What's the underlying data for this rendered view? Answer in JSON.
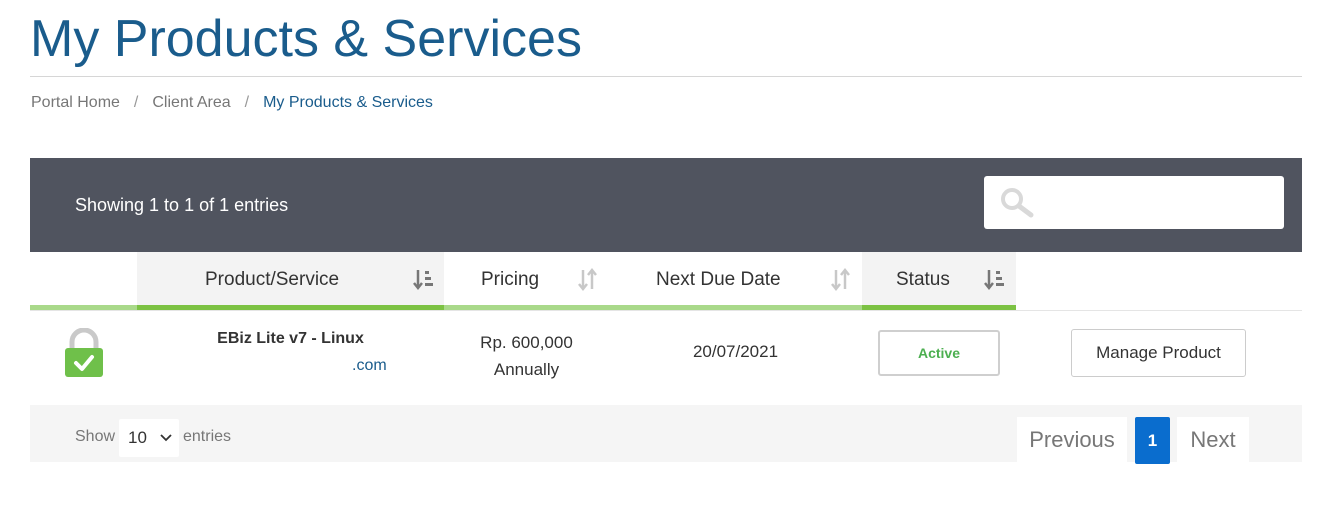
{
  "page": {
    "title": "My Products & Services"
  },
  "breadcrumb": [
    {
      "label": "Portal Home"
    },
    {
      "label": "Client Area"
    },
    {
      "label": "My Products & Services"
    }
  ],
  "breadcrumb_separator": "/",
  "table": {
    "info": "Showing 1 to 1 of 1 entries",
    "search_placeholder": "",
    "columns": [
      {
        "label": "Product/Service",
        "sort": "sorted"
      },
      {
        "label": "Pricing",
        "sort": "unsorted"
      },
      {
        "label": "Next Due Date",
        "sort": "unsorted"
      },
      {
        "label": "Status",
        "sort": "sorted"
      }
    ],
    "rows": [
      {
        "product": "EBiz Lite v7 - Linux",
        "domain": ".com",
        "price": "Rp. 600,000",
        "cycle": "Annually",
        "due_date": "20/07/2021",
        "status": "Active",
        "action": "Manage Product"
      }
    ]
  },
  "footer": {
    "show_label": "Show",
    "length_value": "10",
    "entries_label": "entries",
    "previous": "Previous",
    "current_page": "1",
    "next": "Next"
  },
  "colors": {
    "title": "#1a5c8c",
    "header_bar": "#50545f",
    "accent_green": "#7cc243",
    "status_active": "#4caf50",
    "page_active": "#0a6dce"
  },
  "icons": {
    "search": "search-icon",
    "lock": "padlock-check-icon",
    "sort_sorted": "sort-amount-down-icon",
    "sort_unsorted": "sort-arrows-icon",
    "select": "chevron-down-icon"
  }
}
